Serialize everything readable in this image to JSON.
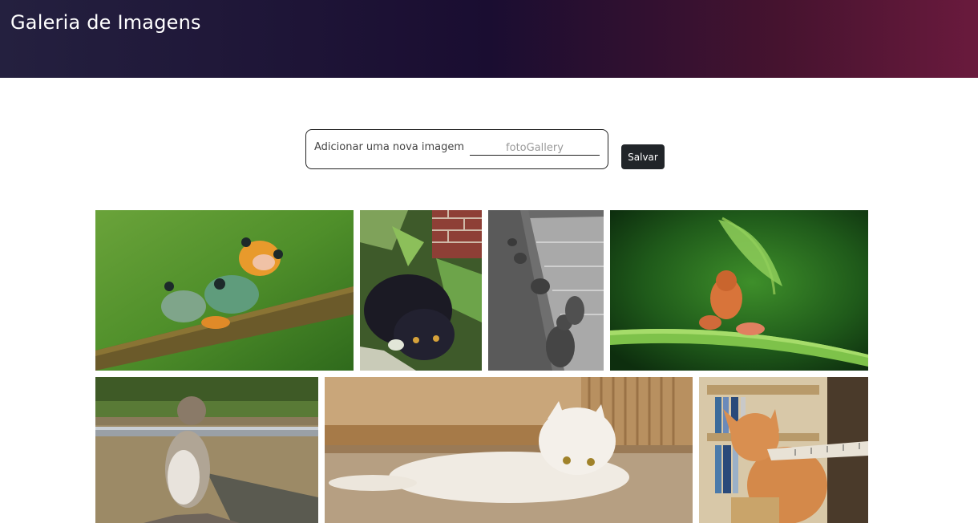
{
  "header": {
    "title": "Galeria de Imagens"
  },
  "form": {
    "label": "Adicionar uma nova imagem",
    "input_value": "",
    "input_placeholder": "fotoGallery",
    "save_label": "Salvar"
  },
  "gallery": {
    "images": [
      {
        "name": "frogs-on-branch"
      },
      {
        "name": "black-cat-in-plants"
      },
      {
        "name": "cats-on-seawall"
      },
      {
        "name": "frog-with-leaf-umbrella"
      },
      {
        "name": "cat-leaning-on-rail"
      },
      {
        "name": "white-cat-lying"
      },
      {
        "name": "cat-biting-ruler"
      }
    ]
  }
}
